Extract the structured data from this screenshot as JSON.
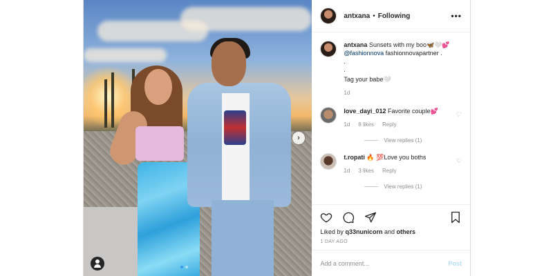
{
  "post": {
    "username": "antxana",
    "separator": "•",
    "follow_status": "Following",
    "more_glyph": "•••"
  },
  "caption": {
    "username": "antxana",
    "text": "Sunsets with my boo🦋🤍💕",
    "mention": "@fashionnova",
    "tag_text": "fashionnovapartner .",
    "line2": ".",
    "line3": ".",
    "line4": "Tag your babe🤍",
    "time": "1d"
  },
  "comments": [
    {
      "username": "love_dayi_012",
      "text": "Favorite couple💕",
      "time": "1d",
      "likes": "8 likes",
      "reply_label": "Reply",
      "view_replies": "View replies (1)"
    },
    {
      "username": "t.ropati",
      "text": "🔥 💯Love you boths",
      "time": "1d",
      "likes": "3 likes",
      "reply_label": "Reply",
      "view_replies": "View replies (1)"
    }
  ],
  "liked_by": {
    "prefix": "Liked by",
    "user": "q33nunicorn",
    "middle": "and",
    "others": "others"
  },
  "time_ago": "1 DAY AGO",
  "add_comment": {
    "placeholder": "Add a comment...",
    "post_label": "Post"
  },
  "photo_nav": {
    "next_glyph": "›"
  },
  "icons": {
    "like": "heart-icon",
    "comment": "comment-icon",
    "share": "share-icon",
    "save": "bookmark-icon"
  },
  "colors": {
    "accent_blue": "#3897f0",
    "post_disabled": "#b2dffc",
    "mention": "#00376b",
    "muted": "#8e8e8e"
  }
}
